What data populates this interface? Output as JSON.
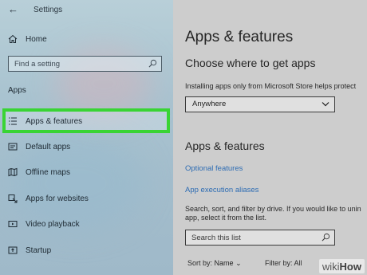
{
  "window": {
    "title": "Settings"
  },
  "sidebar": {
    "home_label": "Home",
    "search_placeholder": "Find a setting",
    "section_title": "Apps",
    "items": [
      {
        "label": "Apps & features",
        "icon": "list-icon",
        "selected": true
      },
      {
        "label": "Default apps",
        "icon": "default-apps-icon"
      },
      {
        "label": "Offline maps",
        "icon": "map-icon"
      },
      {
        "label": "Apps for websites",
        "icon": "web-link-icon"
      },
      {
        "label": "Video playback",
        "icon": "video-icon"
      },
      {
        "label": "Startup",
        "icon": "startup-icon"
      }
    ],
    "highlight_color": "#39d434"
  },
  "main": {
    "title": "Apps & features",
    "choose_heading": "Choose where to get apps",
    "install_text": "Installing apps only from Microsoft Store helps protect",
    "source_dropdown": {
      "selected": "Anywhere"
    },
    "apps_heading": "Apps & features",
    "links": [
      "Optional features",
      "App execution aliases"
    ],
    "description_lines": [
      "Search, sort, and filter by drive. If you would like to unin",
      "app, select it from the list."
    ],
    "list_search_placeholder": "Search this list",
    "sort_label": "Sort by:",
    "sort_value": "Name",
    "filter_label": "Filter by: All",
    "link_color": "#2d6cb3"
  },
  "watermark": {
    "part1": "wiki",
    "part2": "How"
  }
}
